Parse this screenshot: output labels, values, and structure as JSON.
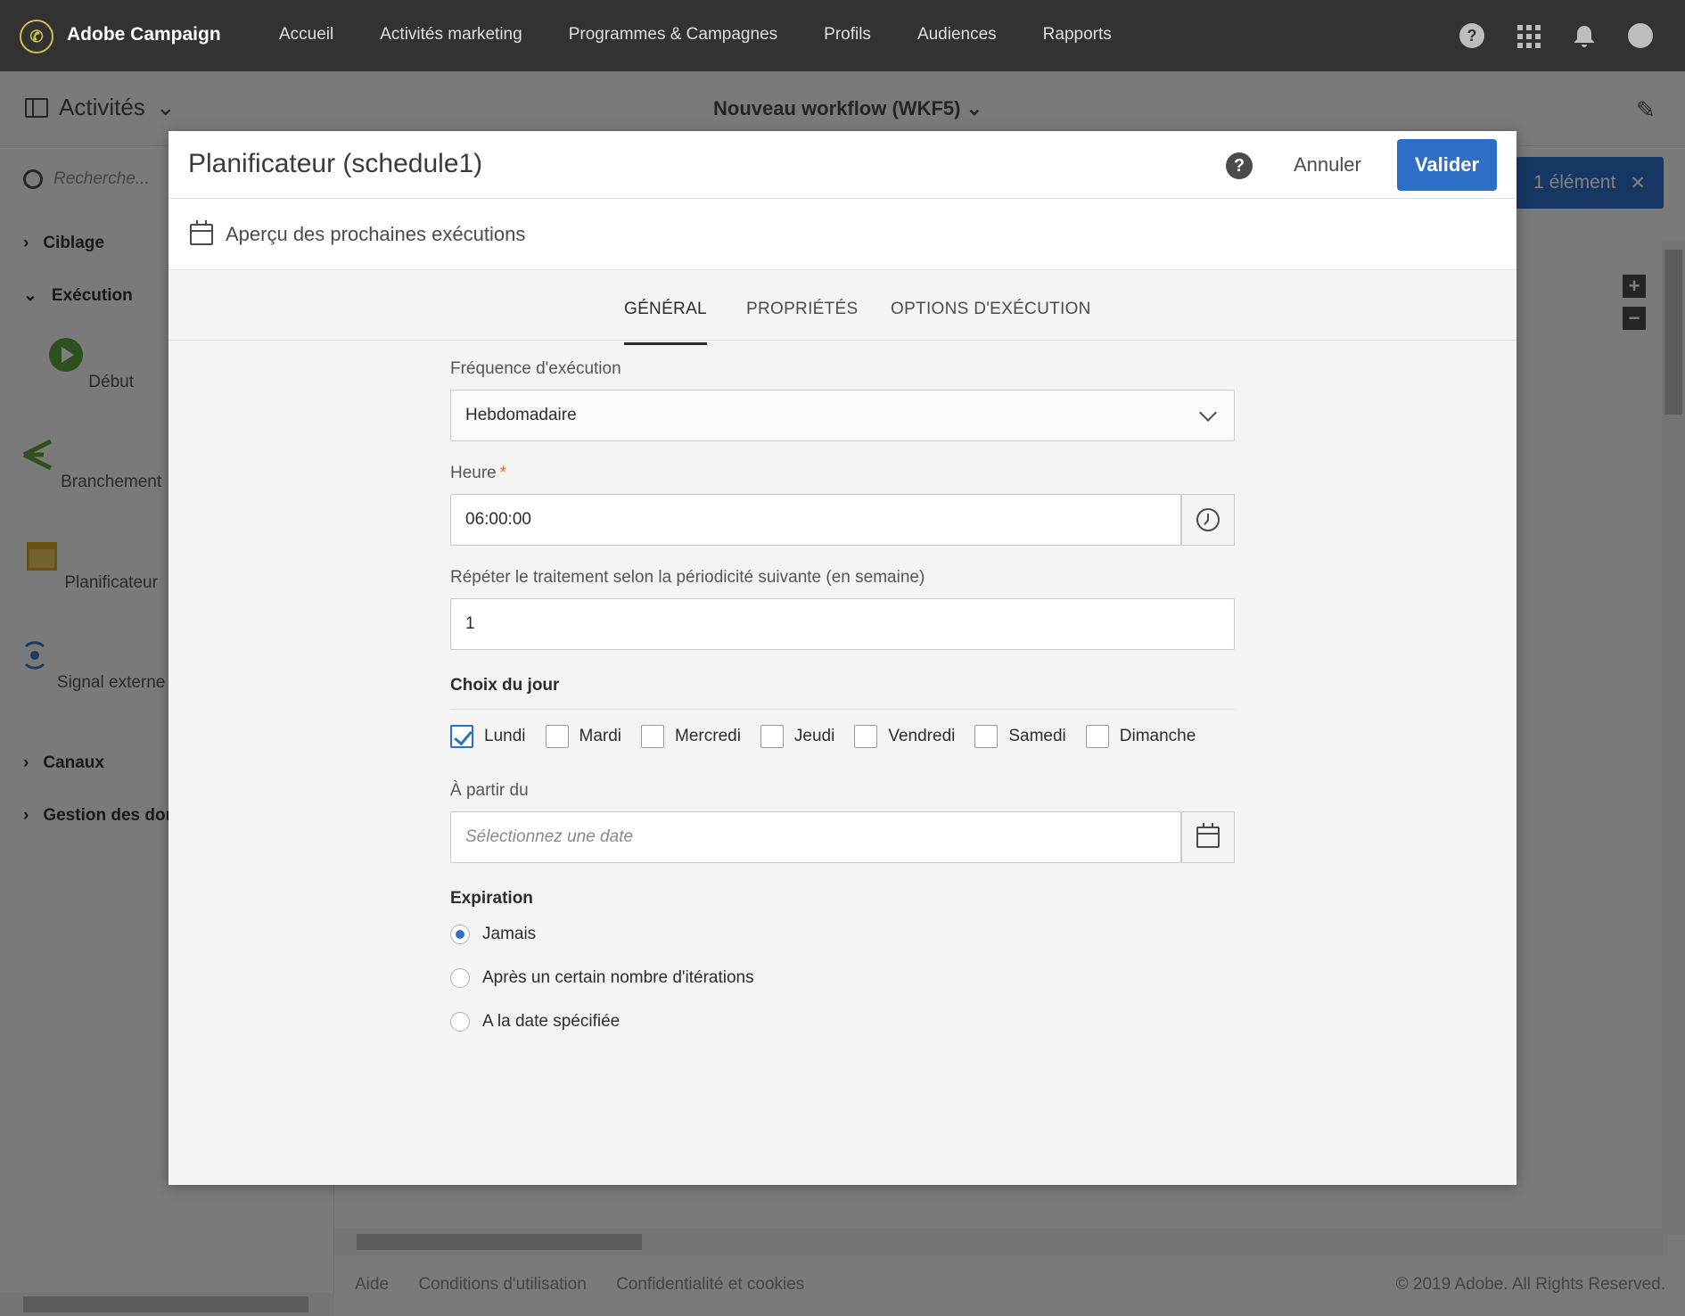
{
  "app": {
    "brand": "Adobe Campaign",
    "nav": [
      "Accueil",
      "Activités marketing",
      "Programmes & Campagnes",
      "Profils",
      "Audiences",
      "Rapports"
    ]
  },
  "subheader": {
    "panel_title": "Activités",
    "workflow_title": "Nouveau workflow (WKF5)"
  },
  "sidebar": {
    "search_placeholder": "Recherche...",
    "categories": {
      "ciblage": "Ciblage",
      "execution": "Exécution",
      "canaux": "Canaux",
      "gestion": "Gestion des donn"
    },
    "tools": {
      "debut": "Début",
      "branchement": "Branchement",
      "planificateur": "Planificateur",
      "signal": "Signal externe"
    }
  },
  "canvas": {
    "selection_badge": "1 élément"
  },
  "footer": {
    "links": [
      "Aide",
      "Conditions d'utilisation",
      "Confidentialité et cookies"
    ],
    "copyright": "© 2019 Adobe. All Rights Reserved."
  },
  "dialog": {
    "title": "Planificateur (schedule1)",
    "cancel_label": "Annuler",
    "ok_label": "Valider",
    "preview_label": "Aperçu des prochaines exécutions",
    "tabs": [
      "GÉNÉRAL",
      "PROPRIÉTÉS",
      "OPTIONS D'EXÉCUTION"
    ],
    "form": {
      "frequency_label": "Fréquence d'exécution",
      "frequency_value": "Hebdomadaire",
      "time_label": "Heure",
      "time_required": "*",
      "time_value": "06:00:00",
      "repeat_label": "Répéter le traitement selon la périodicité suivante (en semaine)",
      "repeat_value": "1",
      "days_title": "Choix du jour",
      "days": [
        "Lundi",
        "Mardi",
        "Mercredi",
        "Jeudi",
        "Vendredi",
        "Samedi",
        "Dimanche"
      ],
      "days_checked": [
        true,
        false,
        false,
        false,
        false,
        false,
        false
      ],
      "start_label": "À partir du",
      "start_placeholder": "Sélectionnez une date",
      "expiration_title": "Expiration",
      "expiration_options": [
        "Jamais",
        "Après un certain nombre d'itérations",
        "A la date spécifiée"
      ],
      "expiration_selected": "Jamais"
    }
  },
  "colors": {
    "accent": "#2d6fc7",
    "topbar": "#323232",
    "required": "#e8651b"
  }
}
